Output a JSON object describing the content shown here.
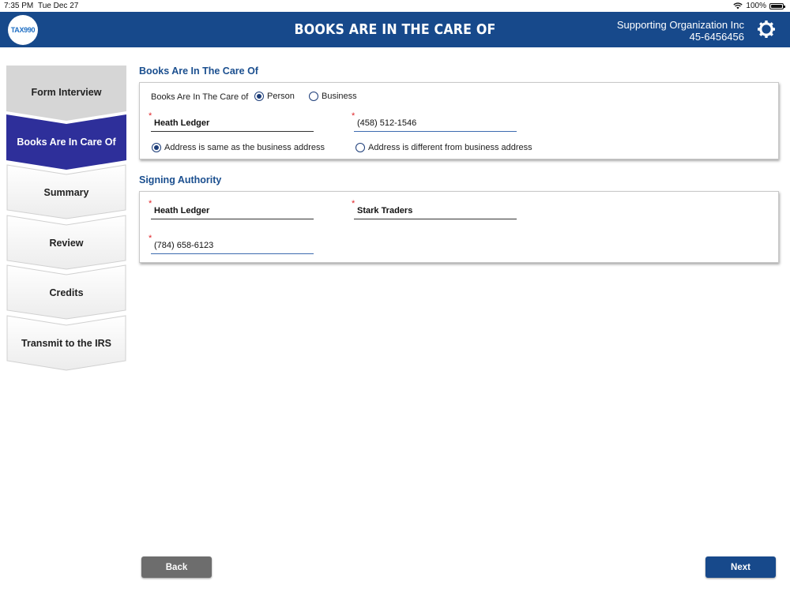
{
  "status": {
    "time": "7:35 PM",
    "date": "Tue Dec 27",
    "battery": "100%"
  },
  "header": {
    "logo_text": "TAX990",
    "title": "BOOKS ARE IN THE CARE OF",
    "org_name": "Supporting Organization Inc",
    "org_ein": "45-6456456"
  },
  "sidebar": {
    "steps": [
      {
        "label": "Form Interview"
      },
      {
        "label": "Books Are In Care Of"
      },
      {
        "label": "Summary"
      },
      {
        "label": "Review"
      },
      {
        "label": "Credits"
      },
      {
        "label": "Transmit to the IRS"
      }
    ]
  },
  "books_section": {
    "title": "Books Are In The Care Of",
    "care_of_label": "Books Are In The Care of",
    "option_person": "Person",
    "option_business": "Business",
    "selected": "Person",
    "name_value": "Heath Ledger",
    "phone_value": "(458) 512-1546",
    "addr_same": "Address is same as the business address",
    "addr_diff": "Address is different from business address",
    "addr_selected": "same"
  },
  "signing_section": {
    "title": "Signing Authority",
    "name_value": "Heath Ledger",
    "title_value": "Stark Traders",
    "phone_value": "(784) 658-6123"
  },
  "buttons": {
    "back": "Back",
    "next": "Next"
  },
  "colors": {
    "header": "#17498b",
    "active_step": "#2e2f9a",
    "section_title": "#1b4f8f",
    "required": "#e0262a"
  }
}
